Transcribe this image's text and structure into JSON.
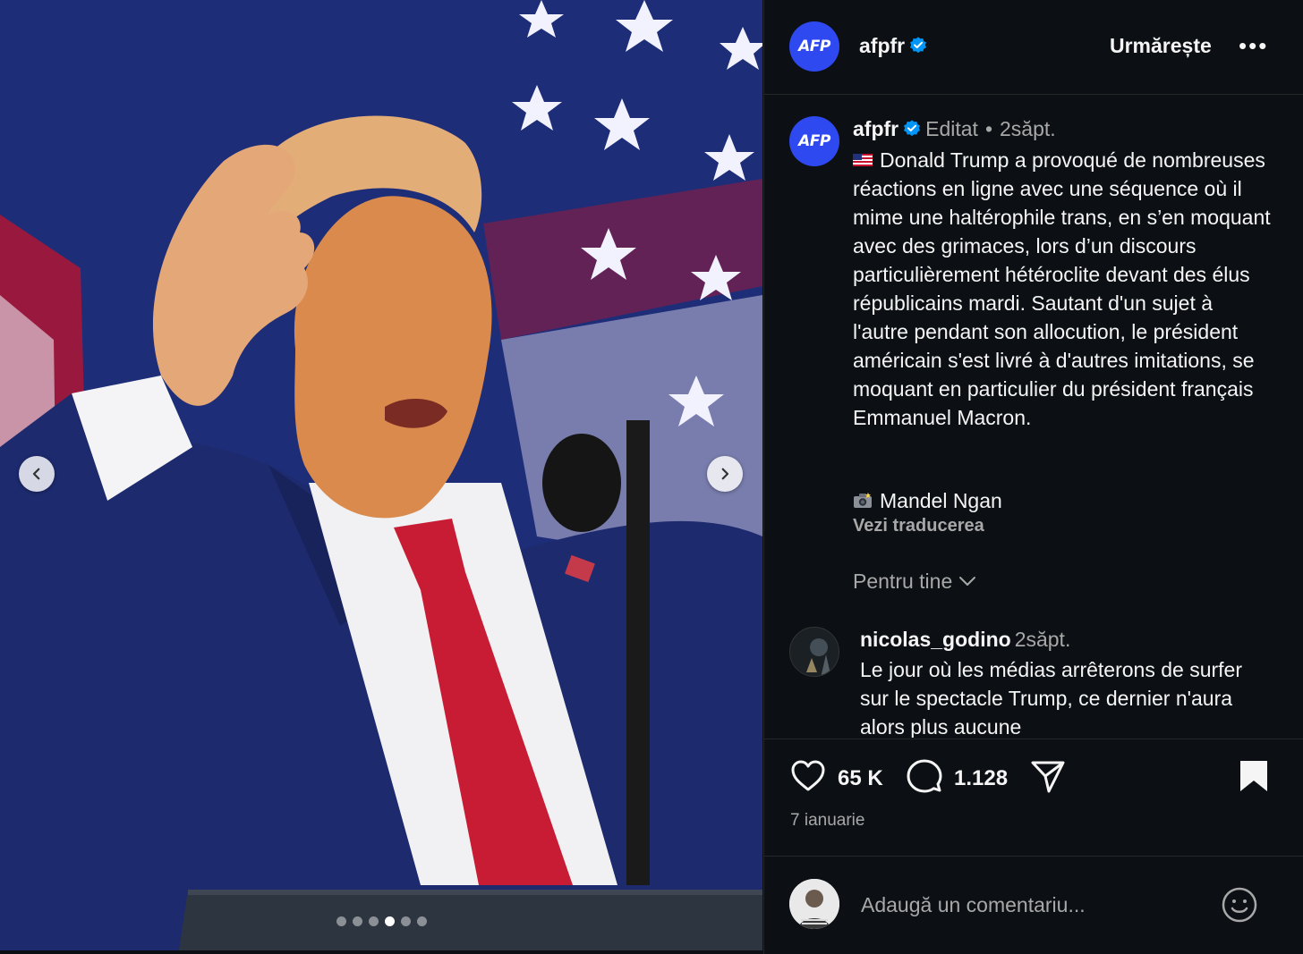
{
  "header": {
    "avatar_text": "AFP",
    "username": "afpfr",
    "follow_label": "Urmărește",
    "more_label": "•••"
  },
  "caption": {
    "avatar_text": "AFP",
    "username": "afpfr",
    "edited_label": "Editat",
    "separator": "•",
    "time": "2săpt.",
    "text": "Donald Trump a provoqué de nombreuses réactions en ligne avec une séquence où il mime une haltérophile trans, en s’en moquant avec des grimaces, lors d’un discours particulièrement hétéroclite devant des élus républicains mardi. Sautant d'un sujet à l'autre pendant son allocution, le président américain s'est livré à d'autres imitations, se moquant en particulier du président français Emmanuel Macron.",
    "credit": "Mandel Ngan",
    "translate_label": "Vezi traducerea"
  },
  "filter": {
    "label": "Pentru tine"
  },
  "comment": {
    "username": "nicolas_godino",
    "time": "2săpt.",
    "text": "Le jour où les médias arrêterons de surfer sur le spectacle Trump, ce dernier n'aura alors plus aucune"
  },
  "actions": {
    "likes": "65 K",
    "comments": "1.128",
    "date": "7 ianuarie"
  },
  "add_comment": {
    "placeholder": "Adaugă un comentariu..."
  },
  "carousel": {
    "slide_count": 6,
    "active_index": 3
  },
  "colors": {
    "background": "#0c1014",
    "afp_blue": "#2f49f0",
    "verified": "#0095f6",
    "muted_text": "#a8a8a8"
  },
  "icons": [
    "chevron-left-icon",
    "chevron-right-icon",
    "verified-icon",
    "more-icon",
    "us-flag-icon",
    "camera-icon",
    "chevron-down-icon",
    "heart-icon",
    "comment-icon",
    "share-icon",
    "bookmark-icon",
    "emoji-icon"
  ]
}
